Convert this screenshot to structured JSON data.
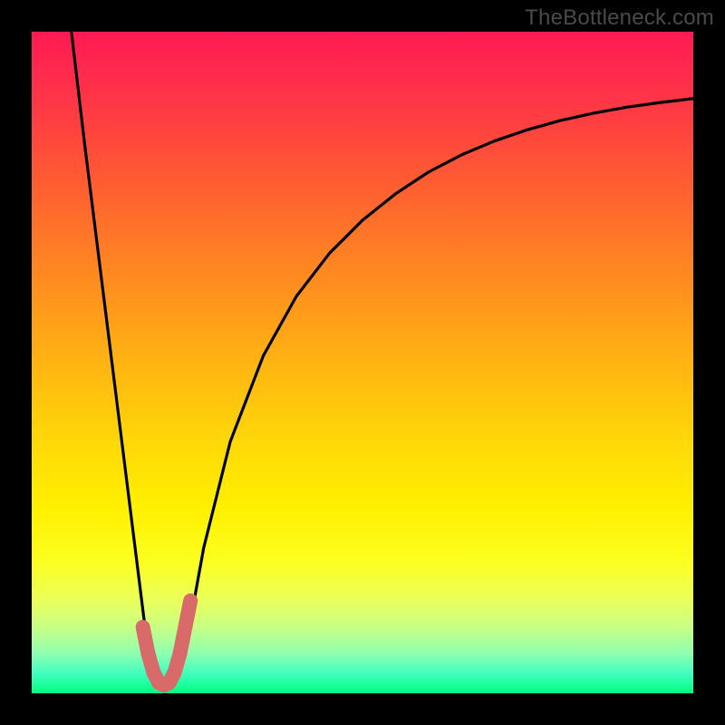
{
  "watermark": "TheBottleneck.com",
  "colors": {
    "frame": "#000000",
    "curve": "#000000",
    "marker": "#d96a6a"
  },
  "chart_data": {
    "type": "line",
    "title": "",
    "xlabel": "",
    "ylabel": "",
    "xlim": [
      0,
      100
    ],
    "ylim": [
      0,
      100
    ],
    "series": [
      {
        "name": "bottleneck-curve",
        "x": [
          6,
          8,
          10,
          12,
          14,
          16,
          17,
          18,
          19,
          20,
          21,
          22,
          23,
          24,
          26,
          30,
          35,
          40,
          45,
          50,
          55,
          60,
          65,
          70,
          75,
          80,
          85,
          90,
          95,
          100
        ],
        "y": [
          100,
          83,
          67,
          51,
          35,
          19,
          11,
          6,
          3,
          1.5,
          1.5,
          3,
          6,
          11,
          22,
          38,
          51,
          60,
          66.5,
          71.5,
          75.5,
          78.8,
          81.4,
          83.5,
          85.2,
          86.6,
          87.7,
          88.6,
          89.3,
          89.9
        ]
      }
    ],
    "markers": {
      "name": "optimal-range",
      "shape": "round-cap-segments",
      "color": "#d96a6a",
      "x": [
        16.8,
        17.6,
        18.4,
        19.2,
        20.0,
        20.8,
        21.6,
        22.4,
        23.2,
        24.0
      ],
      "y": [
        10.0,
        6.0,
        3.2,
        1.6,
        1.2,
        1.6,
        3.2,
        6.0,
        10.0,
        14.0
      ]
    }
  }
}
